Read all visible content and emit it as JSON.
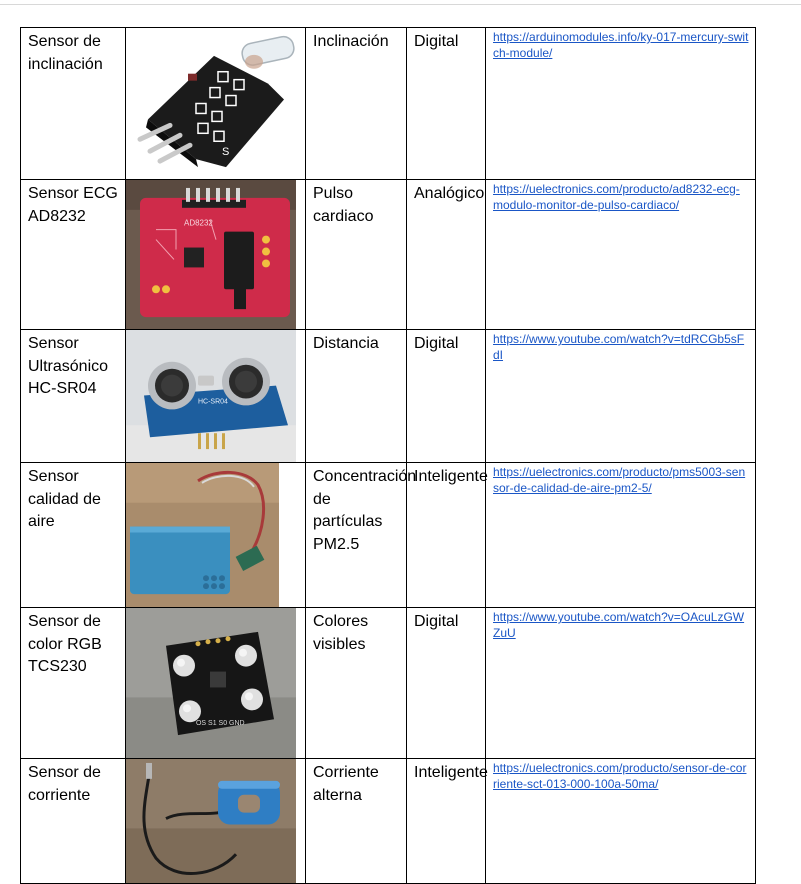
{
  "rows": [
    {
      "name": "Sensor de inclinación",
      "function": "Inclinación",
      "type": "Digital",
      "link": "https://arduinomodules.info/ky-017-mercury-switch-module/",
      "image": "mercury-tilt-switch-module-photo"
    },
    {
      "name": "Sensor ECG AD8232",
      "function": "Pulso cardiaco",
      "type": "Analógico",
      "link": "https://uelectronics.com/producto/ad8232-ecg-modulo-monitor-de-pulso-cardiaco/",
      "image": "ecg-ad8232-board-photo"
    },
    {
      "name": "Sensor Ultrasónico HC-SR04",
      "function": "Distancia",
      "type": "Digital",
      "link": "https://www.youtube.com/watch?v=tdRCGb5sFdI",
      "image": "ultrasonic-sensor-photo"
    },
    {
      "name": "Sensor calidad de aire",
      "function": "Concentración de partículas PM2.5",
      "type": "Inteligente",
      "link": "https://uelectronics.com/producto/pms5003-sensor-de-calidad-de-aire-pm2-5/",
      "image": "air-quality-sensor-photo"
    },
    {
      "name": "Sensor de color RGB TCS230",
      "function": "Colores visibles",
      "type": "Digital",
      "link": "https://www.youtube.com/watch?v=OAcuLzGWZuU",
      "image": "color-sensor-photo"
    },
    {
      "name": "Sensor de corriente",
      "function": "Corriente alterna",
      "type": "Inteligente",
      "link": "https://uelectronics.com/producto/sensor-de-corriente-sct-013-000-100a-50ma/",
      "image": "current-clamp-sensor-photo"
    }
  ],
  "board_labels": {
    "ecg_header": "AD8232",
    "ultrasonic_label": "HC-SR04",
    "tilt_pin_label": "S",
    "color_pins": "OS S1 S0 GND"
  }
}
